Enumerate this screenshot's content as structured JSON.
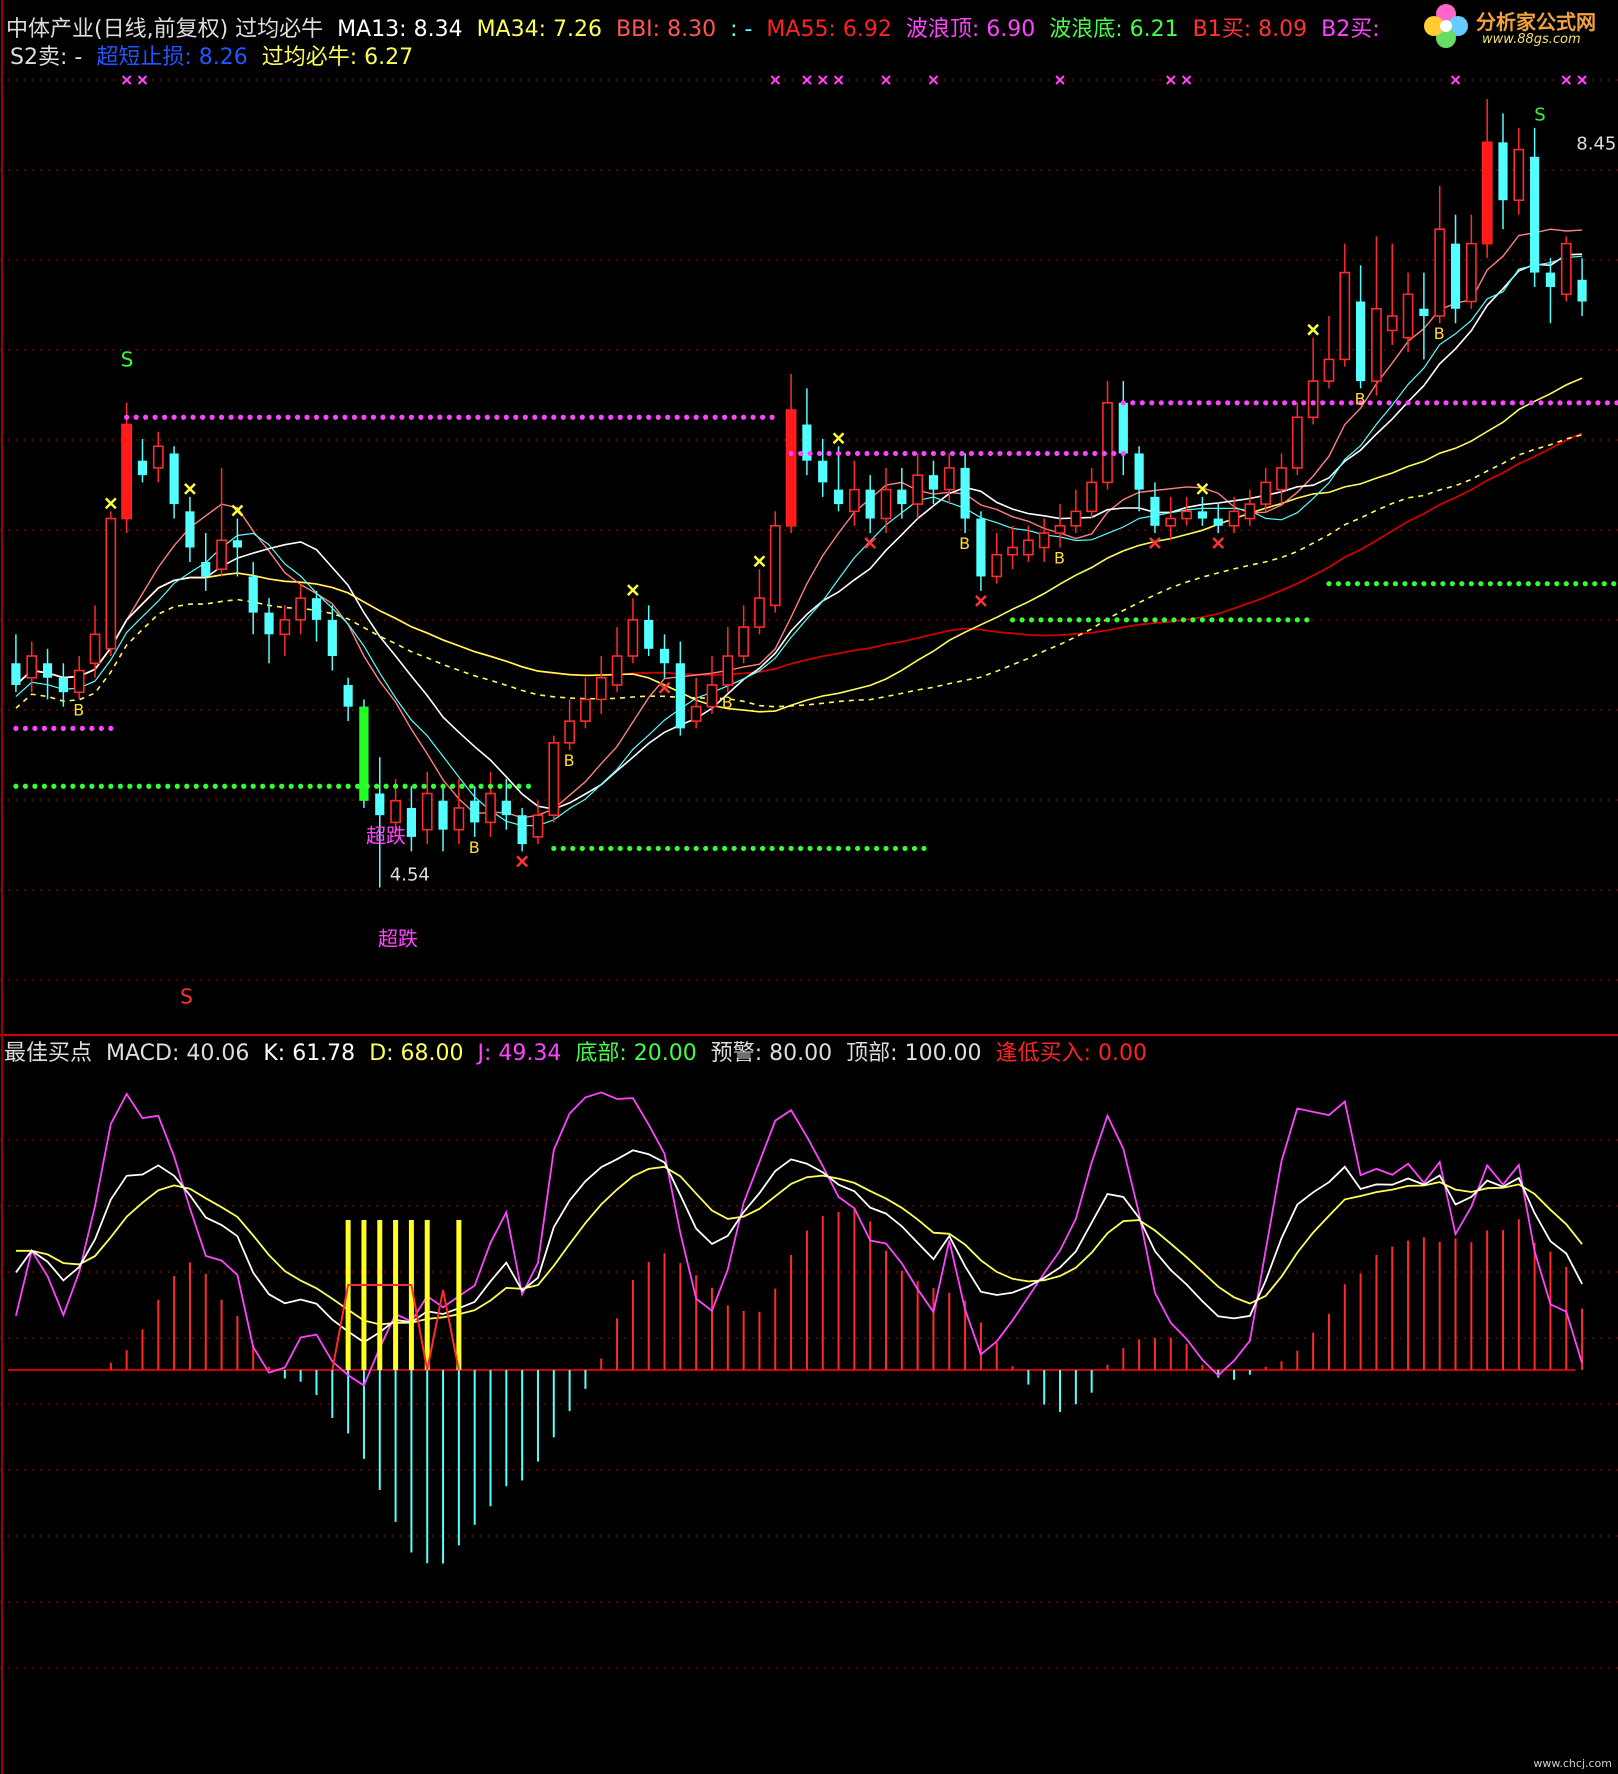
{
  "header": {
    "line1": [
      {
        "text": "中体产业(日线,前复权) 过均必牛",
        "color": "#dddddd"
      },
      {
        "text": "MA13: 8.34",
        "color": "#ffffff"
      },
      {
        "text": "MA34: 7.26",
        "color": "#ffff55"
      },
      {
        "text": "BBI: 8.30",
        "color": "#ff5555"
      },
      {
        "text": ": -",
        "color": "#55ffff"
      },
      {
        "text": "MA55: 6.92",
        "color": "#ff2222"
      },
      {
        "text": "波浪顶: 6.90",
        "color": "#ff44ff"
      },
      {
        "text": "波浪底: 6.21",
        "color": "#44ff44"
      },
      {
        "text": "B1买: 8.09",
        "color": "#ff3333"
      },
      {
        "text": "B2买:",
        "color": "#ff44ff"
      }
    ],
    "line2": [
      {
        "text": "S2卖: -",
        "color": "#dddddd"
      },
      {
        "text": "超短止损: 8.26",
        "color": "#2255ff"
      },
      {
        "text": "过均必牛: 6.27",
        "color": "#ffff55"
      }
    ]
  },
  "indicator_header": [
    {
      "text": "最佳买点",
      "color": "#dddddd"
    },
    {
      "text": "MACD: 40.06",
      "color": "#dddddd"
    },
    {
      "text": "K: 61.78",
      "color": "#ffffff"
    },
    {
      "text": "D: 68.00",
      "color": "#ffff55"
    },
    {
      "text": "J: 49.34",
      "color": "#ff44ff"
    },
    {
      "text": "底部: 20.00",
      "color": "#44ff44"
    },
    {
      "text": "预警: 80.00",
      "color": "#dddddd"
    },
    {
      "text": "顶部: 100.00",
      "color": "#dddddd"
    },
    {
      "text": "逢低买入: 0.00",
      "color": "#ff2222"
    }
  ],
  "logo": {
    "name": "分析家公式网",
    "url": "www.88gs.com",
    "icon": "pinwheel-flower-icon"
  },
  "watermark": "www.chcj.com",
  "colors": {
    "up": "#ff2a2a",
    "down": "#54ffff",
    "ma13": "#ffffff",
    "ma34": "#ffff55",
    "bbi": "#ff8080",
    "ma55": "#d00000",
    "wave_top": "#ff44ff",
    "wave_bottom": "#33ff33",
    "grid": "#b00000"
  },
  "chart_data": [
    {
      "type": "candlestick",
      "title": "中体产业(日线,前复权) 过均必牛",
      "ylim": [
        3.0,
        9.6
      ],
      "candles": [
        [
          5.5,
          5.35,
          5.7,
          5.3
        ],
        [
          5.4,
          5.55,
          5.65,
          5.3
        ],
        [
          5.5,
          5.4,
          5.6,
          5.25
        ],
        [
          5.4,
          5.3,
          5.5,
          5.2
        ],
        [
          5.3,
          5.45,
          5.55,
          5.25
        ],
        [
          5.5,
          5.7,
          5.9,
          5.4
        ],
        [
          5.6,
          6.5,
          6.55,
          5.55
        ],
        [
          6.5,
          7.15,
          7.3,
          6.4
        ],
        [
          6.9,
          6.8,
          7.05,
          6.75
        ],
        [
          6.85,
          7.0,
          7.1,
          6.75
        ],
        [
          6.95,
          6.6,
          7.0,
          6.5
        ],
        [
          6.55,
          6.3,
          6.65,
          6.2
        ],
        [
          6.2,
          6.1,
          6.4,
          6.0
        ],
        [
          6.15,
          6.35,
          6.85,
          6.1
        ],
        [
          6.35,
          6.3,
          6.5,
          6.1
        ],
        [
          6.1,
          5.85,
          6.2,
          5.7
        ],
        [
          5.85,
          5.7,
          5.95,
          5.5
        ],
        [
          5.7,
          5.8,
          5.9,
          5.55
        ],
        [
          5.8,
          5.95,
          6.05,
          5.7
        ],
        [
          5.95,
          5.8,
          6.0,
          5.65
        ],
        [
          5.8,
          5.55,
          5.9,
          5.45
        ],
        [
          5.35,
          5.2,
          5.4,
          5.1
        ],
        [
          5.2,
          4.55,
          5.25,
          4.5
        ],
        [
          4.6,
          4.45,
          4.85,
          3.95
        ],
        [
          4.4,
          4.55,
          4.7,
          4.3
        ],
        [
          4.5,
          4.3,
          4.65,
          4.2
        ],
        [
          4.35,
          4.6,
          4.75,
          4.25
        ],
        [
          4.55,
          4.35,
          4.65,
          4.2
        ],
        [
          4.35,
          4.5,
          4.7,
          4.25
        ],
        [
          4.55,
          4.4,
          4.65,
          4.3
        ],
        [
          4.4,
          4.6,
          4.75,
          4.3
        ],
        [
          4.55,
          4.45,
          4.7,
          4.35
        ],
        [
          4.45,
          4.25,
          4.5,
          4.2
        ],
        [
          4.3,
          4.45,
          4.55,
          4.25
        ],
        [
          4.45,
          4.95,
          5.0,
          4.4
        ],
        [
          4.95,
          5.1,
          5.25,
          4.9
        ],
        [
          5.1,
          5.25,
          5.4,
          5.05
        ],
        [
          5.25,
          5.4,
          5.55,
          5.15
        ],
        [
          5.35,
          5.55,
          5.75,
          5.3
        ],
        [
          5.55,
          5.8,
          5.95,
          5.5
        ],
        [
          5.8,
          5.6,
          5.9,
          5.55
        ],
        [
          5.6,
          5.5,
          5.7,
          5.4
        ],
        [
          5.5,
          5.05,
          5.65,
          5.0
        ],
        [
          5.1,
          5.2,
          5.4,
          5.05
        ],
        [
          5.2,
          5.35,
          5.55,
          5.15
        ],
        [
          5.35,
          5.55,
          5.75,
          5.3
        ],
        [
          5.55,
          5.75,
          5.9,
          5.5
        ],
        [
          5.75,
          5.95,
          6.15,
          5.7
        ],
        [
          5.9,
          6.45,
          6.55,
          5.85
        ],
        [
          6.45,
          7.25,
          7.5,
          6.4
        ],
        [
          7.15,
          6.9,
          7.4,
          6.8
        ],
        [
          6.9,
          6.75,
          7.05,
          6.65
        ],
        [
          6.7,
          6.6,
          7.0,
          6.55
        ],
        [
          6.55,
          6.7,
          6.9,
          6.45
        ],
        [
          6.7,
          6.5,
          6.8,
          6.4
        ],
        [
          6.5,
          6.7,
          6.85,
          6.4
        ],
        [
          6.7,
          6.6,
          6.85,
          6.5
        ],
        [
          6.6,
          6.8,
          6.95,
          6.5
        ],
        [
          6.8,
          6.7,
          6.9,
          6.6
        ],
        [
          6.7,
          6.85,
          6.95,
          6.6
        ],
        [
          6.85,
          6.5,
          6.95,
          6.4
        ],
        [
          6.5,
          6.1,
          6.55,
          6.0
        ],
        [
          6.1,
          6.25,
          6.4,
          6.05
        ],
        [
          6.25,
          6.3,
          6.45,
          6.15
        ],
        [
          6.25,
          6.35,
          6.45,
          6.2
        ],
        [
          6.3,
          6.4,
          6.5,
          6.2
        ],
        [
          6.4,
          6.45,
          6.6,
          6.3
        ],
        [
          6.45,
          6.55,
          6.7,
          6.4
        ],
        [
          6.55,
          6.75,
          6.85,
          6.5
        ],
        [
          6.75,
          7.3,
          7.45,
          6.7
        ],
        [
          7.3,
          6.95,
          7.45,
          6.8
        ],
        [
          6.95,
          6.7,
          7.0,
          6.55
        ],
        [
          6.65,
          6.45,
          6.75,
          6.4
        ],
        [
          6.45,
          6.5,
          6.65,
          6.35
        ],
        [
          6.5,
          6.55,
          6.65,
          6.45
        ],
        [
          6.55,
          6.5,
          6.65,
          6.45
        ],
        [
          6.5,
          6.45,
          6.6,
          6.4
        ],
        [
          6.45,
          6.55,
          6.65,
          6.4
        ],
        [
          6.5,
          6.6,
          6.7,
          6.45
        ],
        [
          6.6,
          6.75,
          6.85,
          6.55
        ],
        [
          6.7,
          6.85,
          6.95,
          6.6
        ],
        [
          6.85,
          7.2,
          7.3,
          6.8
        ],
        [
          7.2,
          7.45,
          7.75,
          7.15
        ],
        [
          7.45,
          7.6,
          7.9,
          7.4
        ],
        [
          7.6,
          8.2,
          8.4,
          7.55
        ],
        [
          8.0,
          7.45,
          8.25,
          7.4
        ],
        [
          7.45,
          7.95,
          8.45,
          7.35
        ],
        [
          7.8,
          7.9,
          8.4,
          7.7
        ],
        [
          7.75,
          8.05,
          8.2,
          7.65
        ],
        [
          7.95,
          7.9,
          8.2,
          7.6
        ],
        [
          7.9,
          8.5,
          8.8,
          7.85
        ],
        [
          8.4,
          7.95,
          8.6,
          7.85
        ],
        [
          8.0,
          8.4,
          8.6,
          7.95
        ],
        [
          8.4,
          9.1,
          9.4,
          8.3
        ],
        [
          9.1,
          8.7,
          9.3,
          8.5
        ],
        [
          8.7,
          9.05,
          9.2,
          8.6
        ],
        [
          9.0,
          8.2,
          9.2,
          8.1
        ],
        [
          8.2,
          8.1,
          8.3,
          7.85
        ],
        [
          8.05,
          8.4,
          8.45,
          8.0
        ],
        [
          8.15,
          8.0,
          8.3,
          7.9
        ]
      ],
      "label_max": "8.45",
      "label_min": "4.54",
      "annotations": [
        "S",
        "S",
        "超跌",
        "超跌",
        "B",
        "S"
      ]
    },
    {
      "type": "bar",
      "title": "最佳买点",
      "ylim": [
        -50,
        120
      ],
      "series_names": [
        "MACD",
        "K",
        "D",
        "J"
      ],
      "reference_lines": [
        20,
        80,
        100
      ]
    }
  ]
}
